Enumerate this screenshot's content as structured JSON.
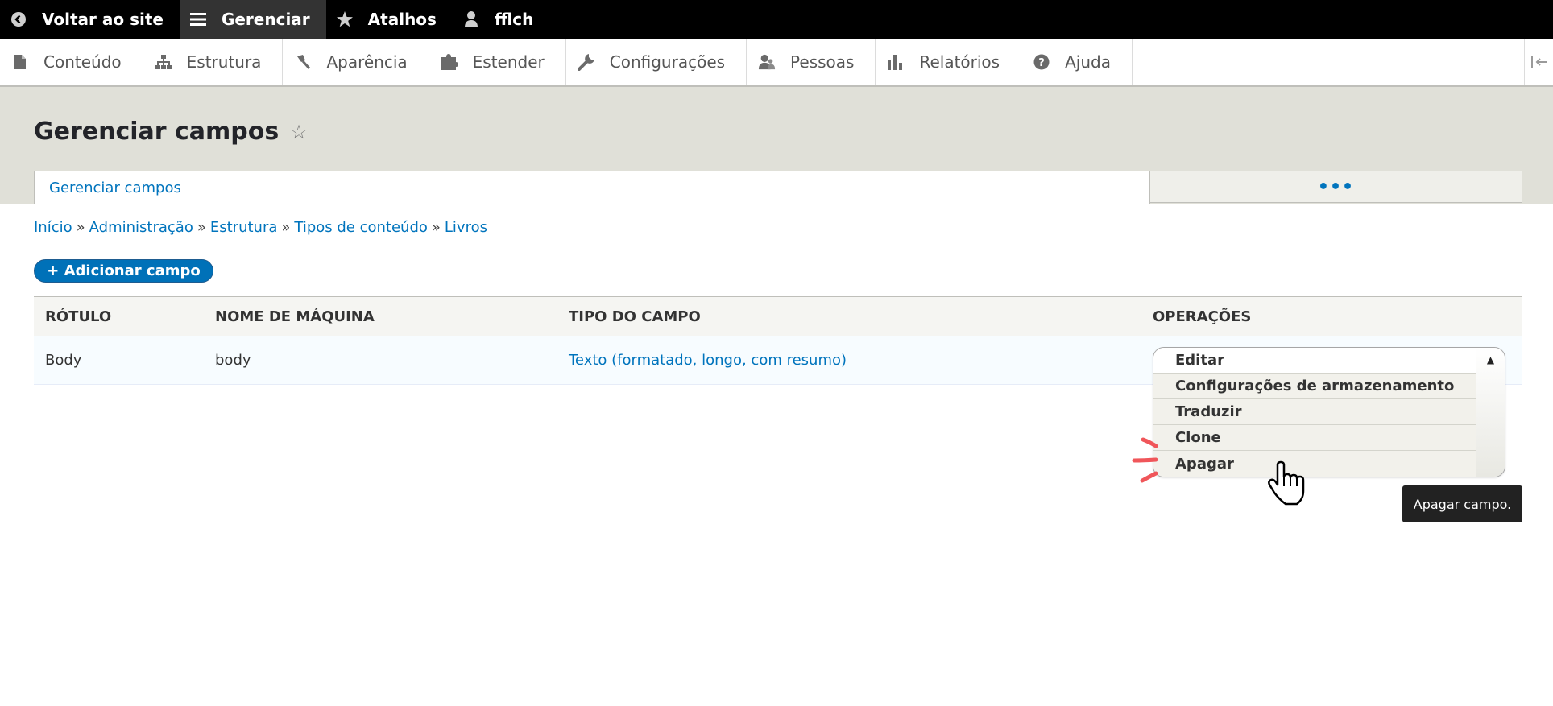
{
  "toolbar": {
    "items": [
      {
        "label": "Voltar ao site",
        "icon": "chevron-left-circle-icon"
      },
      {
        "label": "Gerenciar",
        "icon": "hamburger-menu-icon"
      },
      {
        "label": "Atalhos",
        "icon": "star-icon"
      },
      {
        "label": "fflch",
        "icon": "user-icon"
      }
    ]
  },
  "tray": {
    "items": [
      {
        "label": "Conteúdo",
        "icon": "file-icon"
      },
      {
        "label": "Estrutura",
        "icon": "sitemap-icon"
      },
      {
        "label": "Aparência",
        "icon": "paintbrush-icon"
      },
      {
        "label": "Estender",
        "icon": "puzzle-icon"
      },
      {
        "label": "Configurações",
        "icon": "wrench-icon"
      },
      {
        "label": "Pessoas",
        "icon": "people-icon"
      },
      {
        "label": "Relatórios",
        "icon": "bar-chart-icon"
      },
      {
        "label": "Ajuda",
        "icon": "help-circle-icon"
      }
    ],
    "toggle_icon": "collapse-tray-icon"
  },
  "page": {
    "title": "Gerenciar campos",
    "tab_active": "Gerenciar campos",
    "tab_more": "•••"
  },
  "breadcrumb": {
    "items": [
      "Início",
      "Administração",
      "Estrutura",
      "Tipos de conteúdo",
      "Livros"
    ],
    "separator": "»"
  },
  "add_button": "+ Adicionar campo",
  "table": {
    "headers": [
      "RÓTULO",
      "NOME DE MÁQUINA",
      "TIPO DO CAMPO",
      "OPERAÇÕES"
    ],
    "rows": [
      {
        "label": "Body",
        "machine_name": "body",
        "field_type": "Texto (formatado, longo, com resumo)"
      }
    ]
  },
  "operations": {
    "items": [
      "Editar",
      "Configurações de armazenamento",
      "Traduzir",
      "Clone",
      "Apagar"
    ],
    "toggle": "▲"
  },
  "tooltip": "Apagar campo.",
  "colors": {
    "toolbar_bg": "#000000",
    "header_bg": "#e0e0d8",
    "link": "#0074bd",
    "primary_button": "#0071b8",
    "annotation": "#f0565a"
  }
}
